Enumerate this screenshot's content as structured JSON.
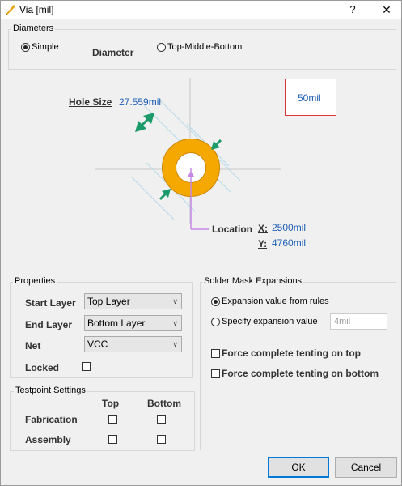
{
  "window": {
    "title": "Via [mil]",
    "help": "?",
    "close": "✕"
  },
  "diameters": {
    "group_label": "Diameters",
    "simple": "Simple",
    "diameter_label": "Diameter",
    "top_middle_bottom": "Top-Middle-Bottom",
    "selected": "Simple"
  },
  "diagram": {
    "hole_size_label": "Hole Size",
    "hole_size_value": "27.559mil",
    "diameter_value": "50mil",
    "location_label": "Location",
    "x_label": "X:",
    "x_value": "2500mil",
    "y_label": "Y:",
    "y_value": "4760mil",
    "colors": {
      "pad": "#f5a800",
      "arrow": "#1b9a6a",
      "guide": "#b5d9e8",
      "location": "#c688e6",
      "highlight": "#d9343a"
    }
  },
  "properties": {
    "group_label": "Properties",
    "start_layer_label": "Start Layer",
    "start_layer_value": "Top Layer",
    "end_layer_label": "End Layer",
    "end_layer_value": "Bottom Layer",
    "net_label": "Net",
    "net_value": "VCC",
    "locked_label": "Locked",
    "locked": false
  },
  "testpoint": {
    "group_label": "Testpoint Settings",
    "col_top": "Top",
    "col_bottom": "Bottom",
    "fabrication_label": "Fabrication",
    "assembly_label": "Assembly"
  },
  "solder_mask": {
    "group_label": "Solder Mask Expansions",
    "from_rules": "Expansion value from rules",
    "specify": "Specify expansion value",
    "specify_value": "4mil",
    "selected": "from_rules",
    "tent_top": "Force complete tenting on top",
    "tent_bottom": "Force complete tenting on bottom"
  },
  "buttons": {
    "ok": "OK",
    "cancel": "Cancel"
  }
}
